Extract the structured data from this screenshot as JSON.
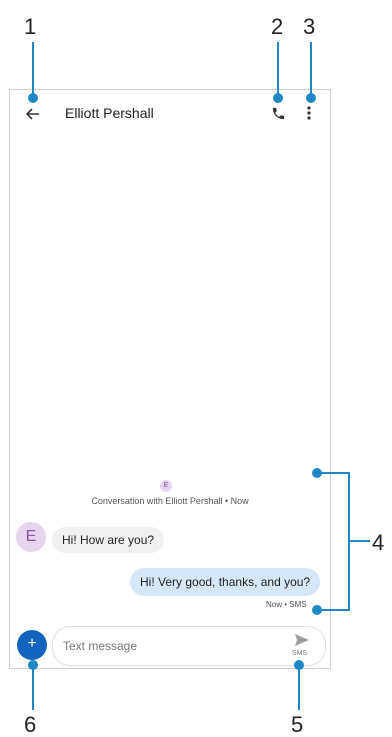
{
  "callouts": [
    "1",
    "2",
    "3",
    "4",
    "5",
    "6"
  ],
  "header": {
    "contact_name": "Elliott Pershall",
    "back_icon": "back-arrow-icon",
    "call_icon": "phone-icon",
    "menu_icon": "more-vert-icon"
  },
  "conversation": {
    "avatar_letter_small": "E",
    "info": "Conversation with Elliott Pershall • Now"
  },
  "messages": {
    "incoming": {
      "avatar_letter": "E",
      "text": "Hi! How are you?"
    },
    "outgoing": {
      "text": "Hi! Very good, thanks, and you?",
      "status": "Now • SMS"
    }
  },
  "compose": {
    "add_label": "+",
    "placeholder": "Text message",
    "send_label": "SMS",
    "send_icon": "send-icon"
  },
  "colors": {
    "callout_line": "#1e88c7",
    "add_button": "#1565c0",
    "outgoing_bubble": "#d7e7fa",
    "incoming_bubble": "#f1f1f1",
    "avatar_bg": "#e6d5ec"
  }
}
